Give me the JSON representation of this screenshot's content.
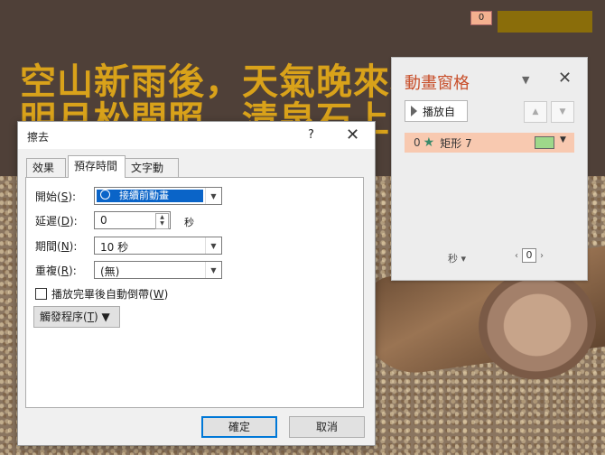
{
  "slide": {
    "poem_line1": "空山新雨後，天氣晚來秋。",
    "poem_line2": "明月松間照，清泉石上流。",
    "animation_tag": "0",
    "colors": {
      "text": "#d9a21a",
      "bg": "#4f4038"
    }
  },
  "pane": {
    "title": "動畫窗格",
    "play_label": "播放自",
    "item": {
      "number": "0",
      "name": "矩形 7",
      "icon": "star-icon"
    },
    "seconds_label": "秒",
    "zoom_value": "0",
    "close_icon": "close-icon"
  },
  "dialog": {
    "title": "擦去",
    "help": "?",
    "tabs": [
      "效果",
      "預存時間",
      "文字動畫"
    ],
    "start": {
      "label": "開始(",
      "key": "S",
      "tail": "):",
      "value": "接續前動畫"
    },
    "delay": {
      "label": "延遲(",
      "key": "D",
      "tail": "):",
      "value": "0",
      "unit": "秒"
    },
    "duration": {
      "label": "期間(",
      "key": "N",
      "tail": "):",
      "value": "10 秒"
    },
    "repeat": {
      "label": "重複(",
      "key": "R",
      "tail": "):",
      "value": "(無)"
    },
    "rewind": {
      "label": "播放完畢後自動倒帶(",
      "key": "W",
      "tail": ")",
      "checked": false
    },
    "triggers": {
      "label": "觸發程序(",
      "key": "T",
      "tail": ")"
    },
    "ok": "確定",
    "cancel": "取消"
  }
}
